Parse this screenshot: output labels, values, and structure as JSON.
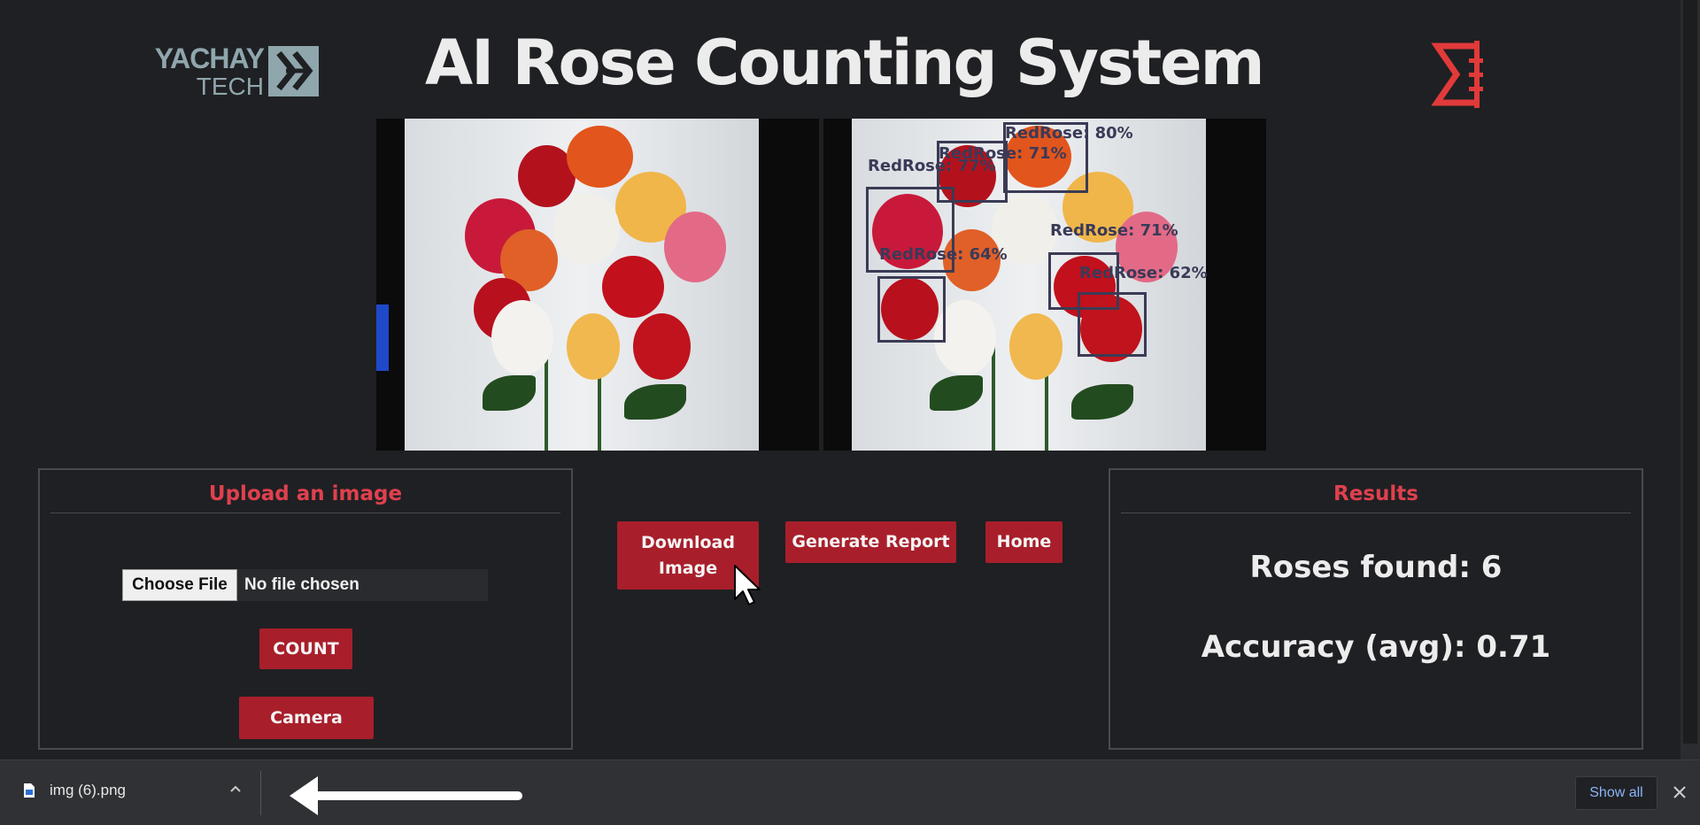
{
  "header": {
    "logo_left_line1": "YACHAY",
    "logo_left_line2": "TECH",
    "title": "AI Rose Counting System"
  },
  "detections": [
    {
      "label": "RedRose: 80%"
    },
    {
      "label": "RedRose: 71%"
    },
    {
      "label": "RedRose: 77%"
    },
    {
      "label": "RedRose: 64%"
    },
    {
      "label": "RedRose: 71%"
    },
    {
      "label": "RedRose: 62%"
    }
  ],
  "upload": {
    "title": "Upload an image",
    "choose_file": "Choose File",
    "file_status": "No file chosen",
    "count_label": "COUNT",
    "camera_label": "Camera"
  },
  "actions": {
    "download_label": "Download Image",
    "report_label": "Generate Report",
    "home_label": "Home"
  },
  "results": {
    "title": "Results",
    "roses_found": "Roses found: 6",
    "accuracy": "Accuracy (avg): 0.71"
  },
  "shelf": {
    "file_name": "img (6).png",
    "show_all": "Show all"
  },
  "colors": {
    "accent_red": "#a81f2b",
    "title_red": "#e0404e",
    "background": "#1f2023"
  }
}
